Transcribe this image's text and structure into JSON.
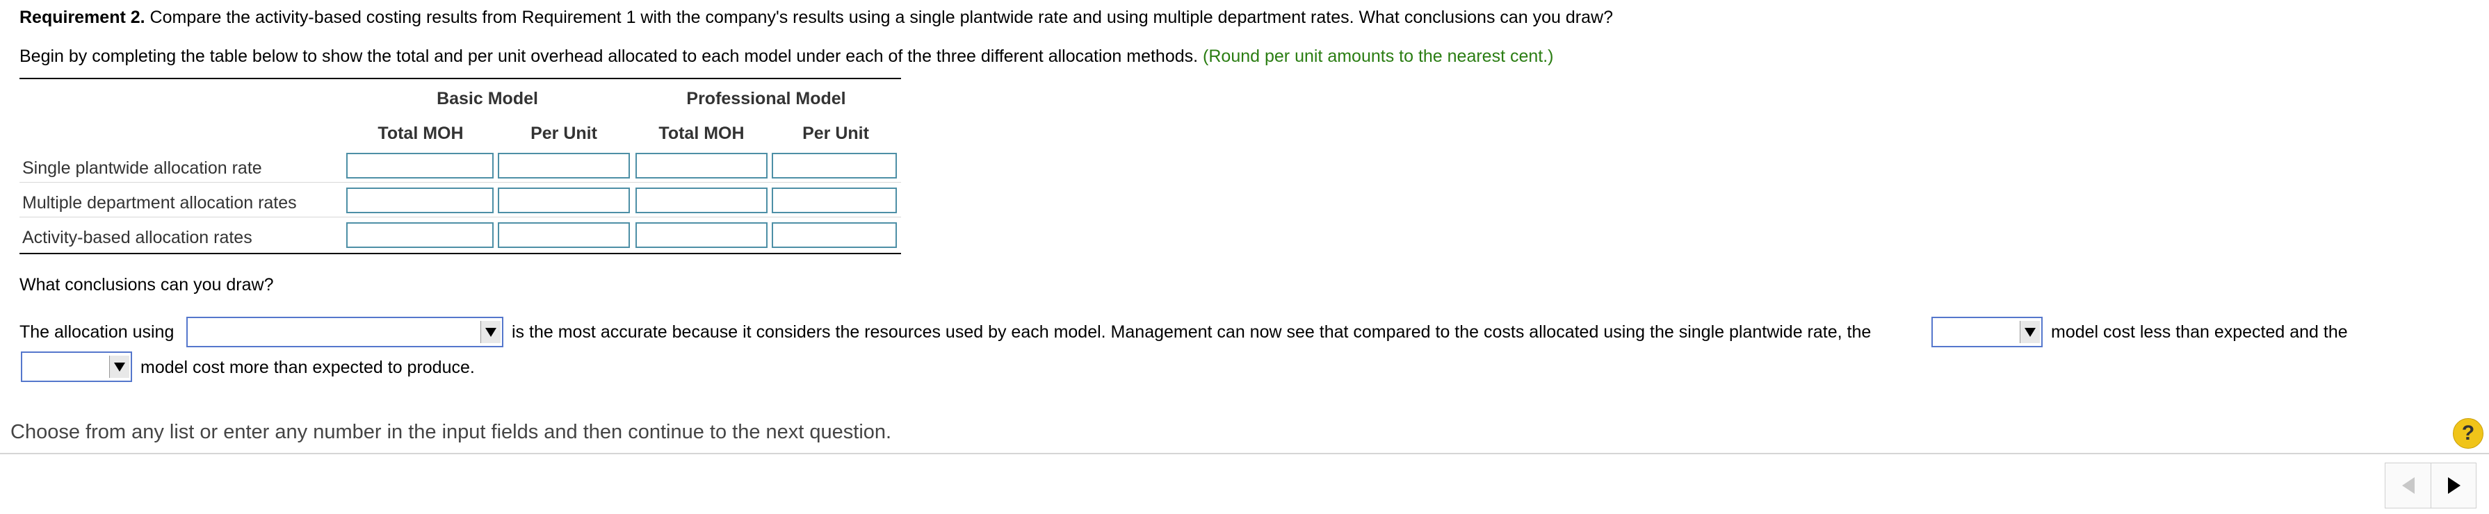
{
  "requirement": {
    "label": "Requirement 2.",
    "text": " Compare the activity-based costing results from Requirement 1 with the company's results using a single plantwide rate and using multiple department rates. What conclusions can you draw?"
  },
  "instruction": {
    "text": "Begin by completing the table below to show the total and per unit overhead allocated to each model under each of the three different allocation methods. ",
    "note": "(Round per unit amounts to the nearest cent.)"
  },
  "table": {
    "groups": [
      "Basic Model",
      "Professional Model"
    ],
    "columns": [
      "Total MOH",
      "Per Unit",
      "Total MOH",
      "Per Unit"
    ],
    "rows": [
      {
        "label": "Single plantwide allocation rate",
        "values": [
          "",
          "",
          "",
          ""
        ]
      },
      {
        "label": "Multiple department allocation rates",
        "values": [
          "",
          "",
          "",
          ""
        ]
      },
      {
        "label": "Activity-based allocation rates",
        "values": [
          "",
          "",
          "",
          ""
        ]
      }
    ]
  },
  "conclusion": {
    "question": "What conclusions can you draw?",
    "part1": "The allocation using",
    "part2": "is the most accurate because it considers the resources used by each model. Management can now see that compared to the costs allocated using the single plantwide rate, the",
    "part3": "model cost less than expected and the",
    "part4": "model cost more than expected to produce.",
    "dropdown1": "",
    "dropdown2": "",
    "dropdown3": ""
  },
  "footer": {
    "help_text": "Choose from any list or enter any number in the input fields and then continue to the next question.",
    "help_button": "?",
    "icons": {
      "help": "question-icon",
      "prev": "triangle-left-icon",
      "next": "triangle-right-icon"
    }
  },
  "colors": {
    "note": "#2a7d12",
    "input_border": "#4d8fa6",
    "dropdown_border": "#5577cc",
    "help_button": "#f0c419"
  }
}
